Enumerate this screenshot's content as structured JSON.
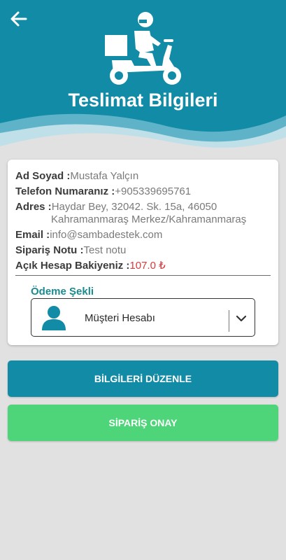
{
  "header": {
    "title": "Teslimat Bilgileri",
    "back_icon": "arrow-left-icon",
    "illustration_icon": "delivery-scooter-icon"
  },
  "info": {
    "name_label": "Ad Soyad :",
    "name_value": "Mustafa Yalçın",
    "phone_label": "Telefon Numaranız :",
    "phone_value": "+905339695761",
    "address_label": "Adres :",
    "address_line1": "Haydar Bey, 32042. Sk. 15a, 46050",
    "address_line2": "Kahramanmaraş Merkez/Kahramanmaraş",
    "email_label": "Email :",
    "email_value": "info@sambadestek.com",
    "note_label": "Sipariş Notu :",
    "note_value": "Test notu",
    "balance_label": "Açık Hesap Bakiyeniz :",
    "balance_value": "107.0 ₺"
  },
  "payment": {
    "label": "Ödeme Şekli",
    "selected": "Müşteri Hesabı",
    "icon": "person-icon"
  },
  "buttons": {
    "edit_label": "BİLGİLERİ DÜZENLE",
    "confirm_label": "SİPARİŞ ONAY"
  },
  "colors": {
    "header_teal": "#128ba6",
    "accent_teal": "#1a8b8f",
    "confirm_green": "#4ed57a",
    "balance_red": "#d93a3a",
    "background": "#e1e1e1"
  }
}
